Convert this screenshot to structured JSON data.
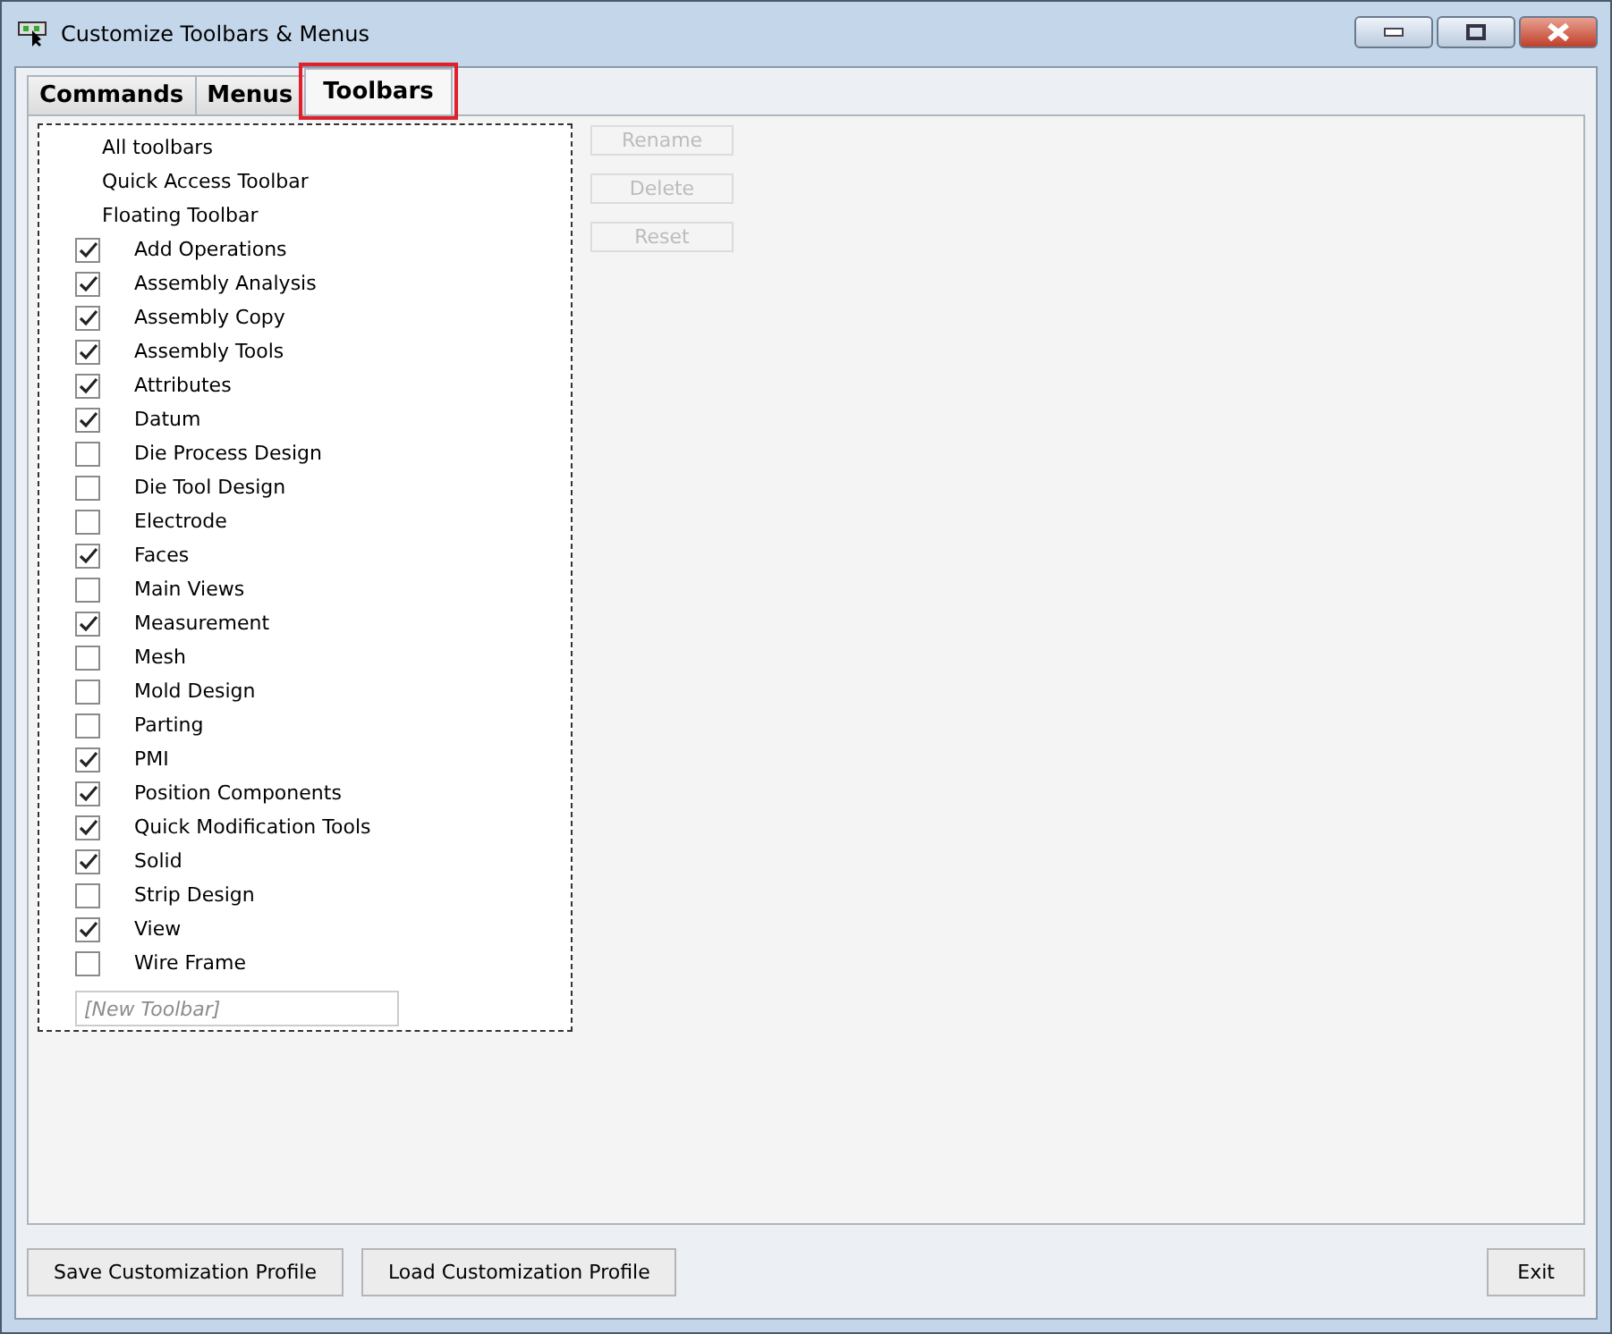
{
  "window": {
    "title": "Customize Toolbars & Menus"
  },
  "tabs": [
    {
      "label": "Commands",
      "selected": false,
      "highlighted": false
    },
    {
      "label": "Menus",
      "selected": false,
      "highlighted": false
    },
    {
      "label": "Toolbars",
      "selected": true,
      "highlighted": true
    }
  ],
  "toolbar_list": [
    {
      "kind": "plain",
      "label": "All toolbars"
    },
    {
      "kind": "plain",
      "label": "Quick Access Toolbar"
    },
    {
      "kind": "plain",
      "label": "Floating Toolbar"
    },
    {
      "kind": "check",
      "label": "Add Operations",
      "checked": true
    },
    {
      "kind": "check",
      "label": "Assembly Analysis",
      "checked": true
    },
    {
      "kind": "check",
      "label": "Assembly Copy",
      "checked": true
    },
    {
      "kind": "check",
      "label": "Assembly Tools",
      "checked": true
    },
    {
      "kind": "check",
      "label": "Attributes",
      "checked": true
    },
    {
      "kind": "check",
      "label": "Datum",
      "checked": true
    },
    {
      "kind": "check",
      "label": "Die Process Design",
      "checked": false
    },
    {
      "kind": "check",
      "label": "Die Tool Design",
      "checked": false
    },
    {
      "kind": "check",
      "label": "Electrode",
      "checked": false
    },
    {
      "kind": "check",
      "label": "Faces",
      "checked": true
    },
    {
      "kind": "check",
      "label": "Main Views",
      "checked": false
    },
    {
      "kind": "check",
      "label": "Measurement",
      "checked": true
    },
    {
      "kind": "check",
      "label": "Mesh",
      "checked": false
    },
    {
      "kind": "check",
      "label": "Mold Design",
      "checked": false
    },
    {
      "kind": "check",
      "label": "Parting",
      "checked": false
    },
    {
      "kind": "check",
      "label": "PMI",
      "checked": true
    },
    {
      "kind": "check",
      "label": "Position Components",
      "checked": true
    },
    {
      "kind": "check",
      "label": "Quick Modification Tools",
      "checked": true
    },
    {
      "kind": "check",
      "label": "Solid",
      "checked": true
    },
    {
      "kind": "check",
      "label": "Strip Design",
      "checked": false
    },
    {
      "kind": "check",
      "label": "View",
      "checked": true
    },
    {
      "kind": "check",
      "label": "Wire Frame",
      "checked": false
    }
  ],
  "new_toolbar": {
    "placeholder": "[New Toolbar]"
  },
  "side_buttons": [
    {
      "label": "Rename",
      "disabled": true
    },
    {
      "label": "Delete",
      "disabled": true
    },
    {
      "label": "Reset",
      "disabled": true
    }
  ],
  "footer_buttons": [
    "Save Customization Profile",
    "Load Customization Profile"
  ],
  "exit_button": "Exit"
}
